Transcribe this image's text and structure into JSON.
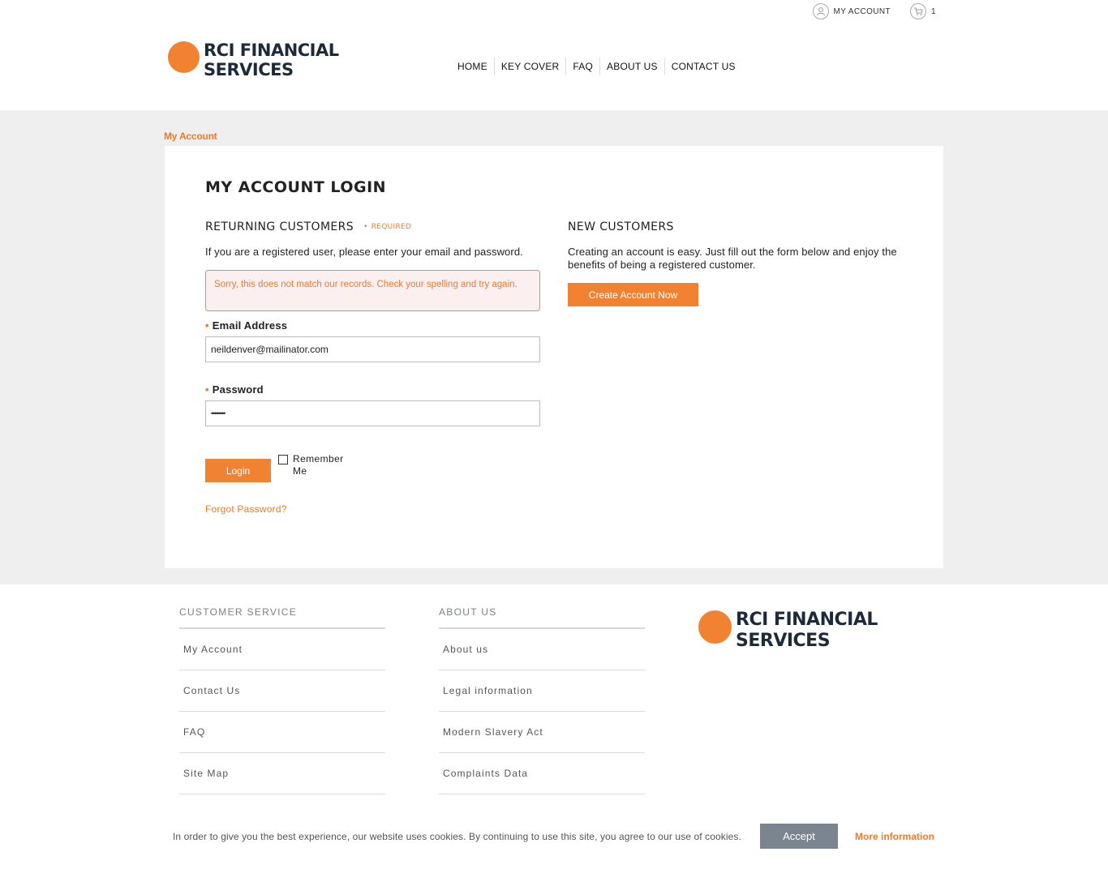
{
  "header": {
    "account_label": "MY ACCOUNT",
    "cart_count": "1",
    "logo_line1": "RCI FINANCIAL",
    "logo_line2": "SERVICES",
    "nav": [
      "HOME",
      "KEY COVER",
      "FAQ",
      "ABOUT US",
      "CONTACT US"
    ]
  },
  "breadcrumb": "My Account",
  "page_title": "MY ACCOUNT LOGIN",
  "returning": {
    "title": "RETURNING CUSTOMERS",
    "required_label": "REQUIRED",
    "intro": "If you are a registered user, please enter your email and password.",
    "error": "Sorry, this does not match our records. Check your spelling and try again.",
    "email_label": "Email Address",
    "email_value": "neildenver@mailinator.com",
    "password_label": "Password",
    "password_value": "••••••••",
    "login_button": "Login",
    "remember_label": "Remember Me",
    "forgot_link": "Forgot Password?"
  },
  "new_customers": {
    "title": "NEW CUSTOMERS",
    "intro": "Creating an account is easy. Just fill out the form below and enjoy the benefits of being a registered customer.",
    "create_button": "Create Account Now"
  },
  "footer": {
    "customer_service": {
      "title": "CUSTOMER SERVICE",
      "links": [
        "My Account",
        "Contact Us",
        "FAQ",
        "Site Map"
      ]
    },
    "about_us": {
      "title": "ABOUT US",
      "links": [
        "About us",
        "Legal information",
        "Modern Slavery Act",
        "Complaints Data"
      ]
    },
    "logo_line1": "RCI FINANCIAL",
    "logo_line2": "SERVICES"
  },
  "cookie": {
    "text": "In order to give you the best experience, our website uses cookies. By continuing to use this site, you agree to our use of cookies.",
    "accept": "Accept",
    "more": "More information"
  },
  "colors": {
    "accent": "#f08231",
    "footer_heading": "#7a828a",
    "accept_button": "#7b858f"
  },
  "icons": [
    "tools-icon",
    "user-icon",
    "cart-icon"
  ]
}
